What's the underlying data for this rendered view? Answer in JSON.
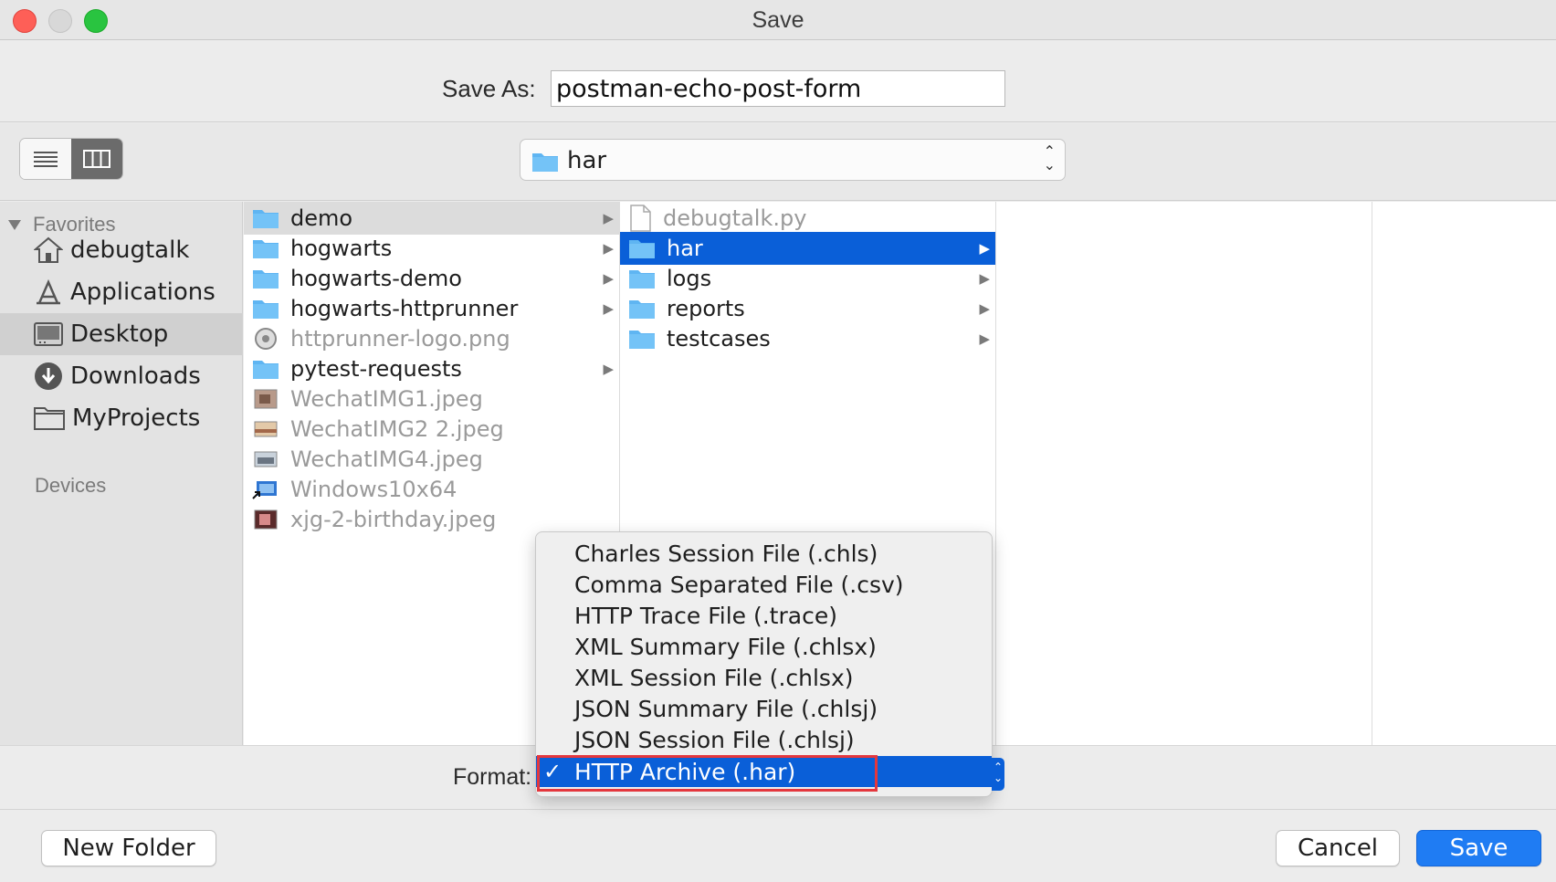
{
  "window": {
    "title": "Save"
  },
  "save_as": {
    "label": "Save As:",
    "value": "postman-echo-post-form"
  },
  "path_popup": {
    "label": "har"
  },
  "sidebar": {
    "favorites_label": "Favorites",
    "items": [
      {
        "label": "debugtalk",
        "icon": "home-icon"
      },
      {
        "label": "Applications",
        "icon": "applications-icon"
      },
      {
        "label": "Desktop",
        "icon": "desktop-icon",
        "selected": true
      },
      {
        "label": "Downloads",
        "icon": "downloads-icon"
      },
      {
        "label": "MyProjects",
        "icon": "folder-icon"
      }
    ],
    "devices_label": "Devices"
  },
  "columns": {
    "col1": [
      {
        "name": "demo",
        "type": "folder",
        "selected": true
      },
      {
        "name": "hogwarts",
        "type": "folder"
      },
      {
        "name": "hogwarts-demo",
        "type": "folder"
      },
      {
        "name": "hogwarts-httprunner",
        "type": "folder"
      },
      {
        "name": "httprunner-logo.png",
        "type": "file"
      },
      {
        "name": "pytest-requests",
        "type": "folder"
      },
      {
        "name": "WechatIMG1.jpeg",
        "type": "file"
      },
      {
        "name": "WechatIMG2 2.jpeg",
        "type": "file"
      },
      {
        "name": "WechatIMG4.jpeg",
        "type": "file"
      },
      {
        "name": "Windows10x64",
        "type": "file"
      },
      {
        "name": "xjg-2-birthday.jpeg",
        "type": "file"
      }
    ],
    "col2": [
      {
        "name": "debugtalk.py",
        "type": "file"
      },
      {
        "name": "har",
        "type": "folder",
        "selected": true
      },
      {
        "name": "logs",
        "type": "folder"
      },
      {
        "name": "reports",
        "type": "folder"
      },
      {
        "name": "testcases",
        "type": "folder"
      }
    ]
  },
  "format": {
    "label": "Format:",
    "options": [
      "Charles Session File (.chls)",
      "Comma Separated File (.csv)",
      "HTTP Trace File (.trace)",
      "XML Summary File (.chlsx)",
      "XML Session File (.chlsx)",
      "JSON Summary File (.chlsj)",
      "JSON Session File (.chlsj)",
      "HTTP Archive (.har)"
    ],
    "selected": "HTTP Archive (.har)",
    "check_mark": "✓"
  },
  "buttons": {
    "new_folder": "New Folder",
    "cancel": "Cancel",
    "save": "Save"
  },
  "colors": {
    "accent": "#0a5fd8",
    "save_button": "#1f7cf3",
    "highlight": "#e4373d",
    "folder": "#5fb5f2"
  }
}
